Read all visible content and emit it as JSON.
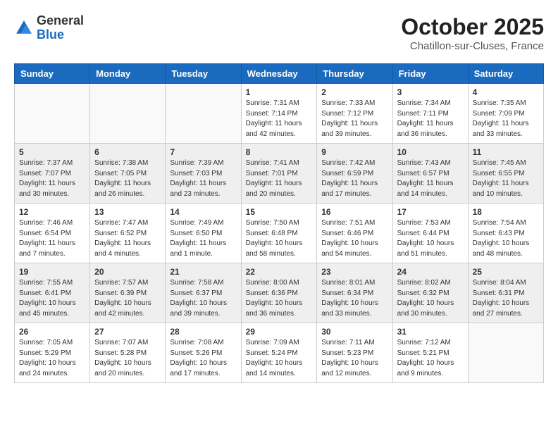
{
  "header": {
    "logo_general": "General",
    "logo_blue": "Blue",
    "month_year": "October 2025",
    "location": "Chatillon-sur-Cluses, France"
  },
  "weekdays": [
    "Sunday",
    "Monday",
    "Tuesday",
    "Wednesday",
    "Thursday",
    "Friday",
    "Saturday"
  ],
  "weeks": [
    [
      {
        "day": "",
        "info": ""
      },
      {
        "day": "",
        "info": ""
      },
      {
        "day": "",
        "info": ""
      },
      {
        "day": "1",
        "info": "Sunrise: 7:31 AM\nSunset: 7:14 PM\nDaylight: 11 hours and 42 minutes."
      },
      {
        "day": "2",
        "info": "Sunrise: 7:33 AM\nSunset: 7:12 PM\nDaylight: 11 hours and 39 minutes."
      },
      {
        "day": "3",
        "info": "Sunrise: 7:34 AM\nSunset: 7:11 PM\nDaylight: 11 hours and 36 minutes."
      },
      {
        "day": "4",
        "info": "Sunrise: 7:35 AM\nSunset: 7:09 PM\nDaylight: 11 hours and 33 minutes."
      }
    ],
    [
      {
        "day": "5",
        "info": "Sunrise: 7:37 AM\nSunset: 7:07 PM\nDaylight: 11 hours and 30 minutes."
      },
      {
        "day": "6",
        "info": "Sunrise: 7:38 AM\nSunset: 7:05 PM\nDaylight: 11 hours and 26 minutes."
      },
      {
        "day": "7",
        "info": "Sunrise: 7:39 AM\nSunset: 7:03 PM\nDaylight: 11 hours and 23 minutes."
      },
      {
        "day": "8",
        "info": "Sunrise: 7:41 AM\nSunset: 7:01 PM\nDaylight: 11 hours and 20 minutes."
      },
      {
        "day": "9",
        "info": "Sunrise: 7:42 AM\nSunset: 6:59 PM\nDaylight: 11 hours and 17 minutes."
      },
      {
        "day": "10",
        "info": "Sunrise: 7:43 AM\nSunset: 6:57 PM\nDaylight: 11 hours and 14 minutes."
      },
      {
        "day": "11",
        "info": "Sunrise: 7:45 AM\nSunset: 6:55 PM\nDaylight: 11 hours and 10 minutes."
      }
    ],
    [
      {
        "day": "12",
        "info": "Sunrise: 7:46 AM\nSunset: 6:54 PM\nDaylight: 11 hours and 7 minutes."
      },
      {
        "day": "13",
        "info": "Sunrise: 7:47 AM\nSunset: 6:52 PM\nDaylight: 11 hours and 4 minutes."
      },
      {
        "day": "14",
        "info": "Sunrise: 7:49 AM\nSunset: 6:50 PM\nDaylight: 11 hours and 1 minute."
      },
      {
        "day": "15",
        "info": "Sunrise: 7:50 AM\nSunset: 6:48 PM\nDaylight: 10 hours and 58 minutes."
      },
      {
        "day": "16",
        "info": "Sunrise: 7:51 AM\nSunset: 6:46 PM\nDaylight: 10 hours and 54 minutes."
      },
      {
        "day": "17",
        "info": "Sunrise: 7:53 AM\nSunset: 6:44 PM\nDaylight: 10 hours and 51 minutes."
      },
      {
        "day": "18",
        "info": "Sunrise: 7:54 AM\nSunset: 6:43 PM\nDaylight: 10 hours and 48 minutes."
      }
    ],
    [
      {
        "day": "19",
        "info": "Sunrise: 7:55 AM\nSunset: 6:41 PM\nDaylight: 10 hours and 45 minutes."
      },
      {
        "day": "20",
        "info": "Sunrise: 7:57 AM\nSunset: 6:39 PM\nDaylight: 10 hours and 42 minutes."
      },
      {
        "day": "21",
        "info": "Sunrise: 7:58 AM\nSunset: 6:37 PM\nDaylight: 10 hours and 39 minutes."
      },
      {
        "day": "22",
        "info": "Sunrise: 8:00 AM\nSunset: 6:36 PM\nDaylight: 10 hours and 36 minutes."
      },
      {
        "day": "23",
        "info": "Sunrise: 8:01 AM\nSunset: 6:34 PM\nDaylight: 10 hours and 33 minutes."
      },
      {
        "day": "24",
        "info": "Sunrise: 8:02 AM\nSunset: 6:32 PM\nDaylight: 10 hours and 30 minutes."
      },
      {
        "day": "25",
        "info": "Sunrise: 8:04 AM\nSunset: 6:31 PM\nDaylight: 10 hours and 27 minutes."
      }
    ],
    [
      {
        "day": "26",
        "info": "Sunrise: 7:05 AM\nSunset: 5:29 PM\nDaylight: 10 hours and 24 minutes."
      },
      {
        "day": "27",
        "info": "Sunrise: 7:07 AM\nSunset: 5:28 PM\nDaylight: 10 hours and 20 minutes."
      },
      {
        "day": "28",
        "info": "Sunrise: 7:08 AM\nSunset: 5:26 PM\nDaylight: 10 hours and 17 minutes."
      },
      {
        "day": "29",
        "info": "Sunrise: 7:09 AM\nSunset: 5:24 PM\nDaylight: 10 hours and 14 minutes."
      },
      {
        "day": "30",
        "info": "Sunrise: 7:11 AM\nSunset: 5:23 PM\nDaylight: 10 hours and 12 minutes."
      },
      {
        "day": "31",
        "info": "Sunrise: 7:12 AM\nSunset: 5:21 PM\nDaylight: 10 hours and 9 minutes."
      },
      {
        "day": "",
        "info": ""
      }
    ]
  ]
}
